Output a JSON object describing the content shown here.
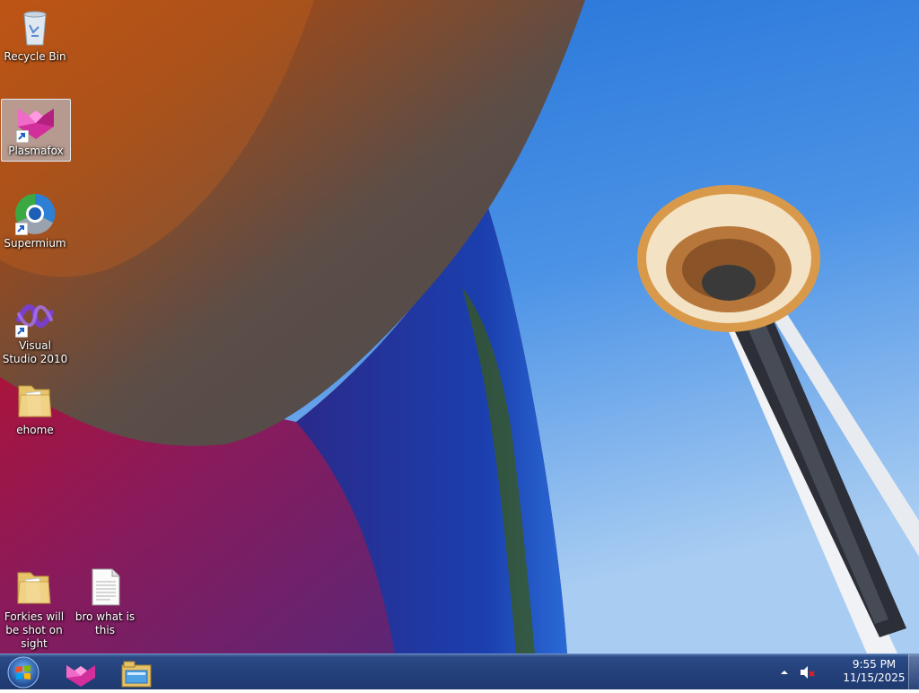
{
  "desktop": {
    "icons": [
      {
        "label": "Recycle Bin",
        "icon": "recycle-bin-icon"
      },
      {
        "label": "Plasmafox",
        "icon": "plasmafox-icon",
        "selected": true
      },
      {
        "label": "Supermium",
        "icon": "supermium-icon"
      },
      {
        "label": "Visual Studio 2010",
        "icon": "visual-studio-icon"
      },
      {
        "label": "ehome",
        "icon": "folder-icon"
      },
      {
        "label": "Forkies will be shot on sight",
        "icon": "folder-icon"
      },
      {
        "label": "bro what is this",
        "icon": "text-file-icon"
      }
    ]
  },
  "taskbar": {
    "start_icon": "windows-logo-icon",
    "pinned": [
      {
        "name": "Plasmafox",
        "icon": "plasmafox-icon"
      },
      {
        "name": "Windows Explorer",
        "icon": "file-explorer-icon"
      }
    ],
    "tray": {
      "time": "9:55 PM",
      "date": "11/15/2025",
      "volume": "muted"
    }
  },
  "colors": {
    "taskbar": "#24407a",
    "sky": "#2f7ad8",
    "selection": "#bed6f0"
  }
}
